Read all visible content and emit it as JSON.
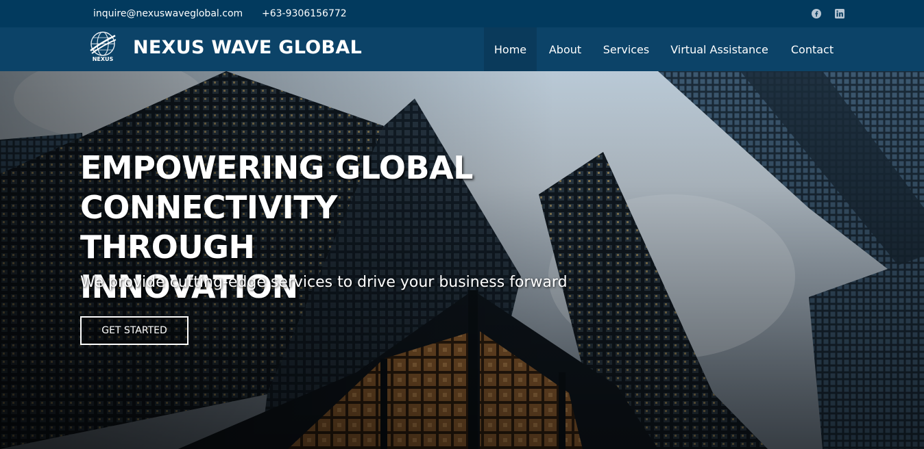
{
  "topbar": {
    "email": "inquire@nexuswaveglobal.com",
    "phone": "+63-9306156772",
    "social": [
      {
        "icon": "facebook-icon"
      },
      {
        "icon": "linkedin-icon"
      }
    ]
  },
  "header": {
    "logo_text": "NEXUS",
    "brand": "NEXUS WAVE GLOBAL",
    "nav": [
      {
        "label": "Home",
        "active": true
      },
      {
        "label": "About"
      },
      {
        "label": "Services"
      },
      {
        "label": "Virtual Assistance"
      },
      {
        "label": "Contact"
      }
    ]
  },
  "hero": {
    "title_lines": [
      "EMPOWERING GLOBAL",
      "CONNECTIVITY THROUGH",
      "INNOVATION"
    ],
    "subtitle": "We provide cutting-edge services to drive your business forward",
    "cta": "GET STARTED"
  },
  "colors": {
    "topbar_bg": "#023a5e",
    "header_bg": "#0c4368",
    "nav_active_bg": "#0a3a5b"
  }
}
